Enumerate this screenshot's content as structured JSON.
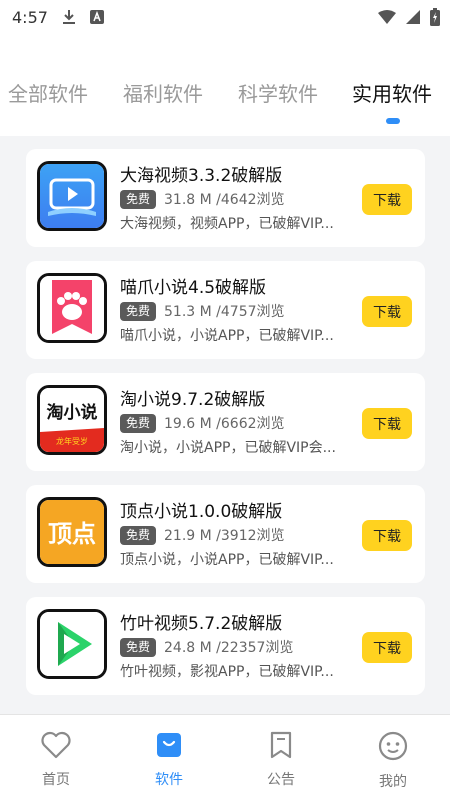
{
  "status_bar": {
    "time": "4:57"
  },
  "tabs": [
    {
      "label": "全部软件",
      "active": false
    },
    {
      "label": "福利软件",
      "active": false
    },
    {
      "label": "科学软件",
      "active": false
    },
    {
      "label": "实用软件",
      "active": true
    }
  ],
  "apps": [
    {
      "title": "大海视频3.3.2破解版",
      "badge": "免费",
      "stats": "31.8 M /4642浏览",
      "desc": "大海视频，视频APP，已破解VIP...",
      "button": "下载",
      "icon": "video-play-icon"
    },
    {
      "title": "喵爪小说4.5破解版",
      "badge": "免费",
      "stats": "51.3 M /4757浏览",
      "desc": "喵爪小说，小说APP，已破解VIP...",
      "button": "下载",
      "icon": "cat-paw-icon"
    },
    {
      "title": "淘小说9.7.2破解版",
      "badge": "免费",
      "stats": "19.6 M /6662浏览",
      "desc": "淘小说，小说APP，已破解VIP会...",
      "button": "下载",
      "icon": "tao-novel-icon",
      "icon_text": "淘小说",
      "icon_subtext": "龙年受岁"
    },
    {
      "title": "顶点小说1.0.0破解版",
      "badge": "免费",
      "stats": "21.9 M /3912浏览",
      "desc": "顶点小说，小说APP，已破解VIP...",
      "button": "下载",
      "icon": "dingdian-icon",
      "icon_text": "顶点"
    },
    {
      "title": "竹叶视频5.7.2破解版",
      "badge": "免费",
      "stats": "24.8 M /22357浏览",
      "desc": "竹叶视频，影视APP，已破解VIP...",
      "button": "下载",
      "icon": "green-play-icon"
    }
  ],
  "bottom_nav": [
    {
      "label": "首页",
      "icon": "heart-icon",
      "active": false
    },
    {
      "label": "软件",
      "icon": "shopping-bag-icon",
      "active": true
    },
    {
      "label": "公告",
      "icon": "bookmark-icon",
      "active": false
    },
    {
      "label": "我的",
      "icon": "smiley-icon",
      "active": false
    }
  ],
  "colors": {
    "accent": "#2f8ef7",
    "download_button": "#ffd21f",
    "badge": "#5a5a5a",
    "background": "#f3f4f6"
  }
}
